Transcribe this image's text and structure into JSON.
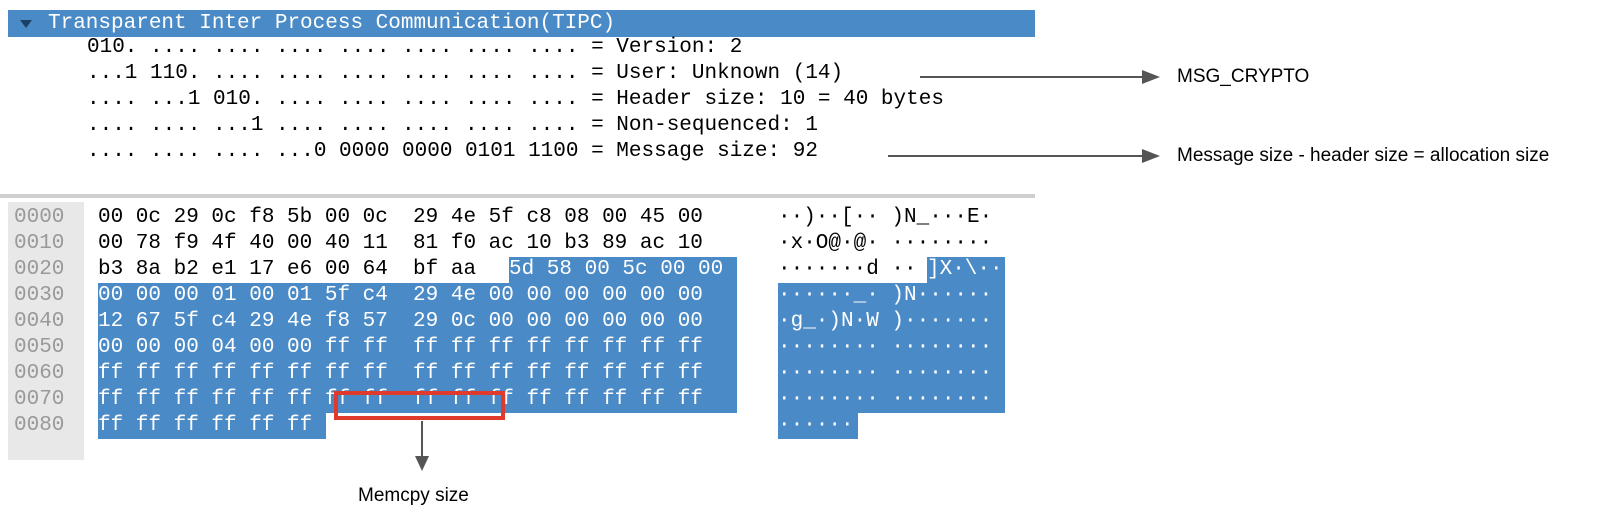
{
  "protocol_tree": {
    "header_title": "Transparent Inter Process Communication(TIPC)",
    "fields": [
      "010. .... .... .... .... .... .... .... = Version: 2",
      "...1 110. .... .... .... .... .... .... = User: Unknown (14)",
      ".... ...1 010. .... .... .... .... .... = Header size: 10 = 40 bytes",
      ".... .... ...1 .... .... .... .... .... = Non-sequenced: 1",
      ".... .... .... ...0 0000 0000 0101 1100 = Message size: 92"
    ]
  },
  "hex_dump": {
    "offsets": [
      "0000",
      "0010",
      "0020",
      "0030",
      "0040",
      "0050",
      "0060",
      "0070",
      "0080"
    ],
    "rows": [
      {
        "hex_plain": "00 0c 29 0c f8 5b 00 0c  29 4e 5f c8 08 00 45 00",
        "hex_sel": "",
        "ascii_plain": "··)··[·· )N_···E·",
        "ascii_sel": ""
      },
      {
        "hex_plain": "00 78 f9 4f 40 00 40 11  81 f0 ac 10 b3 89 ac 10",
        "hex_sel": "",
        "ascii_plain": "·x·O@·@· ········",
        "ascii_sel": ""
      },
      {
        "hex_plain": "b3 8a b2 e1 17 e6 00 64  bf aa ",
        "hex_sel": "5d 58 00 5c 00 00",
        "ascii_plain": "·······d ··",
        "ascii_sel": "]X·\\··"
      },
      {
        "hex_plain": "",
        "hex_sel": "00 00 00 01 00 01 5f c4  29 4e 00 00 00 00 00 00",
        "ascii_plain": "",
        "ascii_sel": "······_· )N······"
      },
      {
        "hex_plain": "",
        "hex_sel": "12 67 5f c4 29 4e f8 57  29 0c 00 00 00 00 00 00",
        "ascii_plain": "",
        "ascii_sel": "·g_·)N·W )·······"
      },
      {
        "hex_plain": "",
        "hex_sel": "00 00 00 04 00 00 ff ff  ff ff ff ff ff ff ff ff",
        "ascii_plain": "",
        "ascii_sel": "········ ········"
      },
      {
        "hex_plain": "",
        "hex_sel": "ff ff ff ff ff ff ff ff  ff ff ff ff ff ff ff ff",
        "ascii_plain": "",
        "ascii_sel": "········ ········"
      },
      {
        "hex_plain": "",
        "hex_sel": "ff ff ff ff ff ff ff ff  ff ff ff ff ff ff ff ff",
        "ascii_plain": "",
        "ascii_sel": "········ ········"
      },
      {
        "hex_plain": "",
        "hex_sel": "ff ff ff ff ff ff",
        "ascii_plain": "",
        "ascii_sel": "······"
      }
    ]
  },
  "annotations": {
    "user": "MSG_CRYPTO",
    "message_size": "Message size - header size = allocation size",
    "memcpy": "Memcpy size"
  },
  "colors": {
    "selection": "#4a8ac6",
    "highlight_box": "#e03a2c",
    "arrow": "#555555"
  }
}
